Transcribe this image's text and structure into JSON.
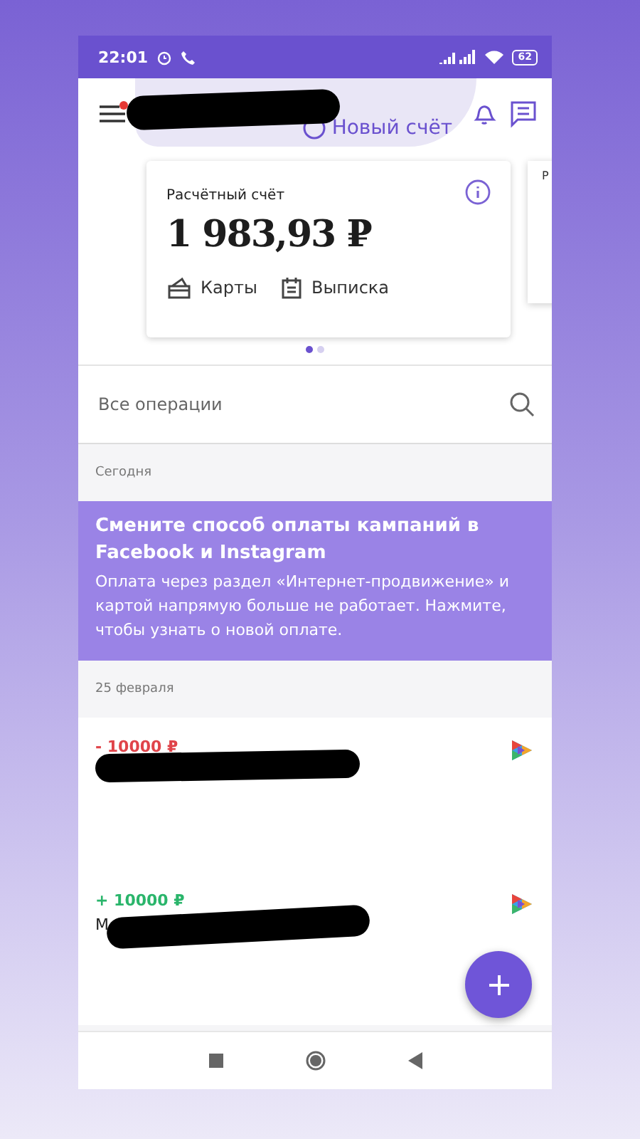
{
  "status_bar": {
    "time": "22:01",
    "battery": "62"
  },
  "header": {
    "new_account": "Новый счёт",
    "notification_dot": true
  },
  "account_card": {
    "title": "Расчётный счёт",
    "balance": "1 983,93 ₽",
    "actions": [
      {
        "kind": "cards",
        "label": "Карты"
      },
      {
        "kind": "statement",
        "label": "Выписка"
      }
    ]
  },
  "next_card": {
    "title": "Р"
  },
  "pager": [
    {
      "selected": true
    },
    {
      "selected": false
    }
  ],
  "search": {
    "placeholder": "Все операции"
  },
  "sections": [
    {
      "date": "Сегодня",
      "items": [
        {
          "kind": "banner",
          "title": "Смените способ оплаты кампаний в Facebook и Instagram",
          "text": "Оплата через раздел «Интернет-продвижение» и картой напрямую больше не работает. Нажмите, чтобы узнать о новой оплате."
        }
      ]
    },
    {
      "date": "25 февраля",
      "items": [
        {
          "kind": "operation",
          "color": "#e0444a",
          "amount": "- 10000 ₽"
        },
        {
          "kind": "operation",
          "color": "#2ab56b",
          "amount": "+ 10000 ₽",
          "description": "М"
        }
      ]
    }
  ]
}
